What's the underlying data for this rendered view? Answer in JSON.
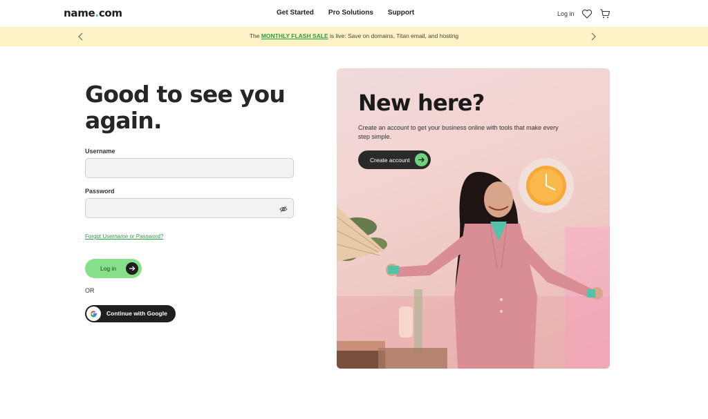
{
  "header": {
    "logo_main": "name",
    "logo_dot": ".",
    "logo_tld": "com",
    "nav": [
      "Get Started",
      "Pro Solutions",
      "Support"
    ],
    "login_label": "Log in"
  },
  "promo": {
    "prefix": "The ",
    "highlight": "MONTHLY FLASH SALE",
    "suffix": " is live: Save on domains, Titan email, and hosting"
  },
  "login": {
    "title": "Good to see you again.",
    "username_label": "Username",
    "username_value": "",
    "password_label": "Password",
    "password_value": "",
    "forgot_link": "Forgot Username or Password?",
    "login_button": "Log in",
    "or_text": "OR",
    "google_button": "Continue with Google"
  },
  "signup_card": {
    "title": "New here?",
    "text": "Create an account to get your business online with tools that make every step simple.",
    "button": "Create account"
  },
  "colors": {
    "brand_green": "#4bc66a",
    "login_button_bg": "#86e08a",
    "promo_bg": "#fdf2c6",
    "dark": "#1f1f1f"
  },
  "icons": {
    "heart": "heart-icon",
    "cart": "cart-icon",
    "eye_off": "eye-off-icon",
    "arrow_right": "arrow-right-icon",
    "chevron_left": "chevron-left-icon",
    "chevron_right": "chevron-right-icon",
    "google": "google-icon"
  }
}
